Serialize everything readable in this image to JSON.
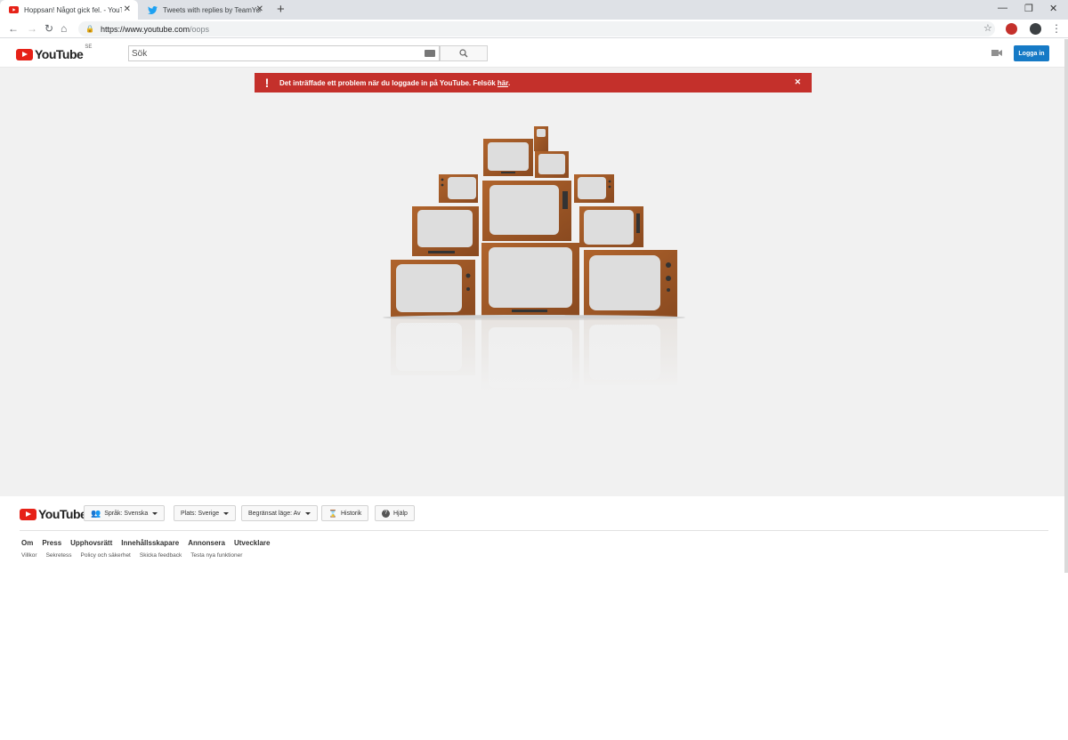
{
  "browser": {
    "tabs": [
      {
        "title": "Hoppsan! Något gick fel. - YouTube"
      },
      {
        "title": "Tweets with replies by TeamYouTube"
      }
    ],
    "url_host": "https://www.youtube.com",
    "url_path": "/oops"
  },
  "header": {
    "logo_text": "YouTube",
    "country_code": "SE",
    "search_placeholder": "Sök",
    "login_label": "Logga in"
  },
  "alert": {
    "message": "Det inträffade ett problem när du loggade in på YouTube. Felsök ",
    "link": "här",
    "end": "."
  },
  "footer": {
    "logo_text": "YouTube",
    "buttons": {
      "language": "Språk: Svenska",
      "location": "Plats: Sverige",
      "restricted": "Begränsat läge: Av",
      "history": "Historik",
      "help": "Hjälp"
    },
    "links_primary": [
      "Om",
      "Press",
      "Upphovsrätt",
      "Innehållsskapare",
      "Annonsera",
      "Utvecklare"
    ],
    "links_secondary": [
      "Villkor",
      "Sekretess",
      "Policy och säkerhet",
      "Skicka feedback",
      "Testa nya funktioner"
    ]
  },
  "colors": {
    "brand_red": "#e62117",
    "alert_red": "#c4302b",
    "login_blue": "#167ac6",
    "tv_wood": "#9a5526"
  },
  "icons": [
    "youtube-favicon",
    "twitter-favicon",
    "lock-icon",
    "star-icon",
    "search-icon",
    "camera-icon",
    "users-icon",
    "hourglass-icon",
    "help-icon"
  ]
}
